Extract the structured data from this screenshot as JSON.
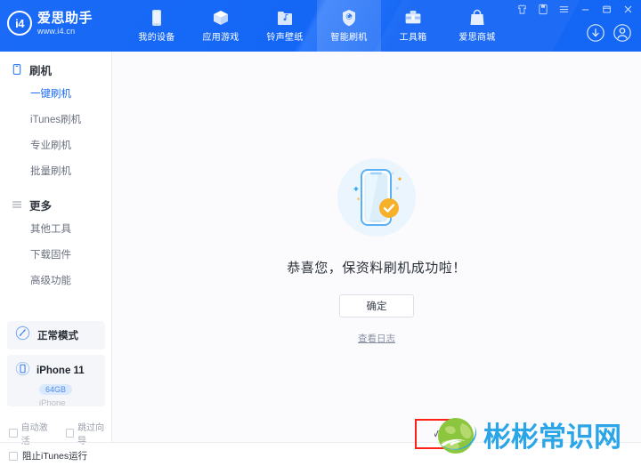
{
  "app": {
    "brand_title": "爱思助手",
    "brand_url": "www.i4.cn",
    "logo_mark": "i4",
    "accent_blue": "#1466f5",
    "link_blue": "#1a6bf7",
    "check_orange": "#f7b029"
  },
  "header": {
    "nav": [
      {
        "label": "我的设备",
        "icon": "phone-icon",
        "active": false
      },
      {
        "label": "应用游戏",
        "icon": "cube-icon",
        "active": false
      },
      {
        "label": "铃声壁纸",
        "icon": "music-folder-icon",
        "active": false
      },
      {
        "label": "智能刷机",
        "icon": "shield-refresh-icon",
        "active": true
      },
      {
        "label": "工具箱",
        "icon": "toolbox-icon",
        "active": false
      },
      {
        "label": "爱思商城",
        "icon": "shopping-bag-icon",
        "active": false
      }
    ],
    "window_controls": [
      {
        "name": "skin-icon"
      },
      {
        "name": "message-icon"
      },
      {
        "name": "menu-icon"
      },
      {
        "name": "minimize-icon"
      },
      {
        "name": "maximize-icon"
      },
      {
        "name": "close-icon"
      }
    ],
    "account": [
      {
        "name": "download-icon"
      },
      {
        "name": "user-avatar-icon"
      }
    ]
  },
  "sidebar": {
    "groups": [
      {
        "title": "刷机",
        "icon": "phone-outline-icon",
        "items": [
          {
            "label": "一键刷机",
            "active": true
          },
          {
            "label": "iTunes刷机",
            "active": false
          },
          {
            "label": "专业刷机",
            "active": false
          },
          {
            "label": "批量刷机",
            "active": false
          }
        ]
      },
      {
        "title": "更多",
        "icon": "list-icon",
        "items": [
          {
            "label": "其他工具",
            "active": false
          },
          {
            "label": "下载固件",
            "active": false
          },
          {
            "label": "高级功能",
            "active": false
          }
        ]
      }
    ],
    "mode_card": {
      "label": "正常模式",
      "icon": "mode-icon"
    },
    "device_card": {
      "name": "iPhone 11",
      "capacity": "64GB",
      "type": "iPhone",
      "icon": "device-icon"
    },
    "checkboxes": [
      {
        "label": "自动激活",
        "checked": false
      },
      {
        "label": "跳过向导",
        "checked": false
      }
    ],
    "bottom_checkbox": {
      "label": "阻止iTunes运行",
      "checked": false
    }
  },
  "main": {
    "illustration": "phone-success-illustration",
    "message": "恭喜您，保资料刷机成功啦！",
    "confirm_button": "确定",
    "log_link": "查看日志"
  },
  "annotation": {
    "highlight_color": "#ff2018",
    "boxed_text": "VI"
  },
  "watermark": {
    "text": "彬彬常识网",
    "logo": "globe-icon",
    "text_color": "#2aa6e8",
    "globe_color": "#7ac143"
  }
}
